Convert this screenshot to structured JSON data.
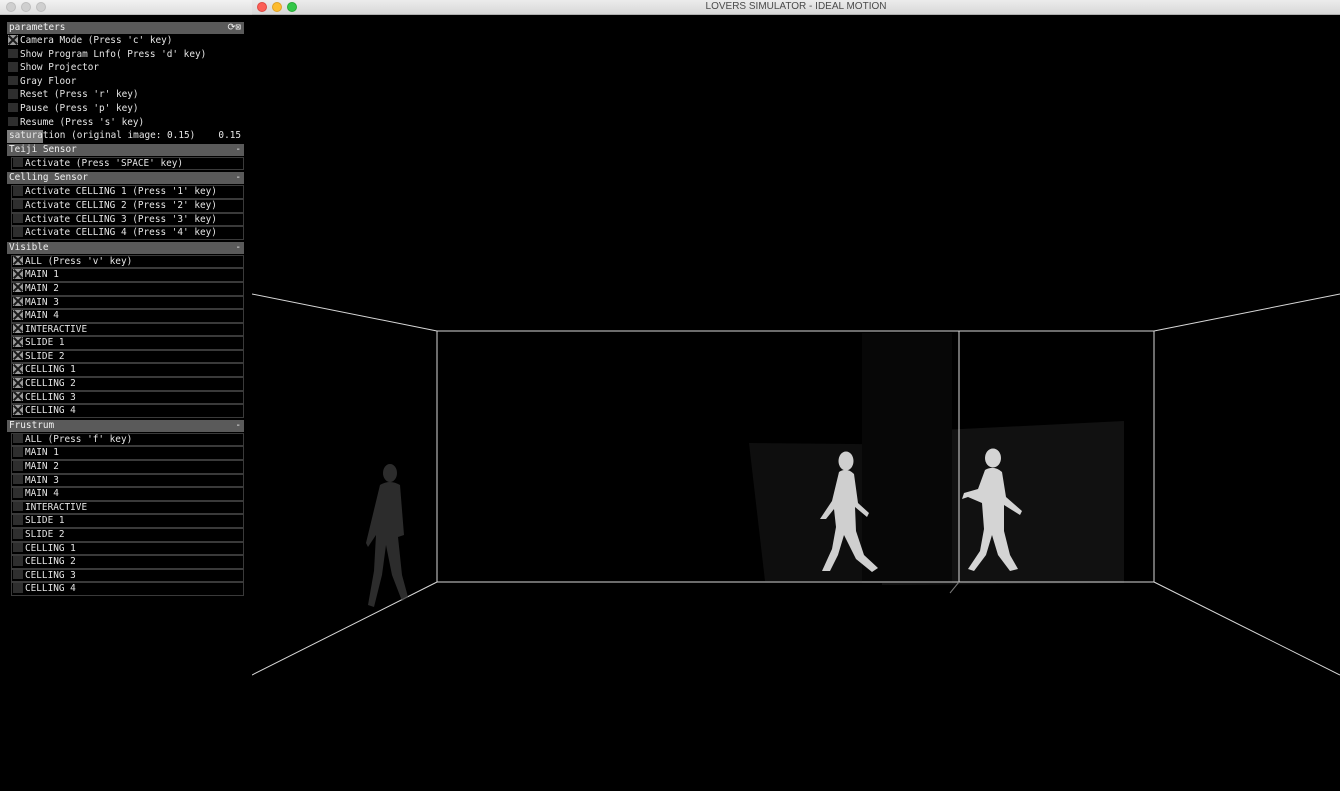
{
  "window": {
    "title": "LOVERS SIMULATOR - IDEAL MOTION"
  },
  "colors": {
    "close": "#fc5f57",
    "minimize": "#fdbc2e",
    "zoom": "#33c748"
  },
  "gui": {
    "title": "parameters",
    "header_icons": "⟳⊠",
    "items": [
      {
        "label": "Camera Mode (Press 'c' key)",
        "checked": true
      },
      {
        "label": "Show Program Lnfo( Press 'd' key)",
        "checked": false
      },
      {
        "label": "Show Projector",
        "checked": false
      },
      {
        "label": "Gray Floor",
        "checked": false
      },
      {
        "label": "Reset (Press 'r' key)",
        "checked": false
      },
      {
        "label": "Pause (Press 'p' key)",
        "checked": false
      },
      {
        "label": "Resume (Press 's' key)",
        "checked": false
      }
    ],
    "saturation": {
      "label": "saturation (original image: 0.15)",
      "value": "0.15",
      "fill": 0.15
    },
    "teiji": {
      "title": "Teiji Sensor",
      "collapse": "-",
      "items": [
        {
          "label": "Activate (Press 'SPACE' key)",
          "checked": false
        }
      ]
    },
    "celling_sensor": {
      "title": "Celling Sensor",
      "collapse": "-",
      "items": [
        {
          "label": "Activate CELLING 1 (Press '1' key)",
          "checked": false
        },
        {
          "label": "Activate CELLING 2 (Press '2' key)",
          "checked": false
        },
        {
          "label": "Activate CELLING 3 (Press '3' key)",
          "checked": false
        },
        {
          "label": "Activate CELLING 4 (Press '4' key)",
          "checked": false
        }
      ]
    },
    "visible": {
      "title": "Visible",
      "collapse": "-",
      "items": [
        {
          "label": "ALL (Press 'v' key)",
          "checked": true
        },
        {
          "label": "MAIN 1",
          "checked": true
        },
        {
          "label": "MAIN 2",
          "checked": true
        },
        {
          "label": "MAIN 3",
          "checked": true
        },
        {
          "label": "MAIN 4",
          "checked": true
        },
        {
          "label": "INTERACTIVE",
          "checked": true
        },
        {
          "label": "SLIDE 1",
          "checked": true
        },
        {
          "label": "SLIDE 2",
          "checked": true
        },
        {
          "label": "CELLING 1",
          "checked": true
        },
        {
          "label": "CELLING 2",
          "checked": true
        },
        {
          "label": "CELLING 3",
          "checked": true
        },
        {
          "label": "CELLING 4",
          "checked": true
        }
      ]
    },
    "frustrum": {
      "title": "Frustrum",
      "collapse": "-",
      "items": [
        {
          "label": "ALL (Press 'f' key)",
          "checked": false
        },
        {
          "label": "MAIN 1",
          "checked": false
        },
        {
          "label": "MAIN 2",
          "checked": false
        },
        {
          "label": "MAIN 3",
          "checked": false
        },
        {
          "label": "MAIN 4",
          "checked": false
        },
        {
          "label": "INTERACTIVE",
          "checked": false
        },
        {
          "label": "SLIDE 1",
          "checked": false
        },
        {
          "label": "SLIDE 2",
          "checked": false
        },
        {
          "label": "CELLING 1",
          "checked": false
        },
        {
          "label": "CELLING 2",
          "checked": false
        },
        {
          "label": "CELLING 3",
          "checked": false
        },
        {
          "label": "CELLING 4",
          "checked": false
        }
      ]
    }
  }
}
